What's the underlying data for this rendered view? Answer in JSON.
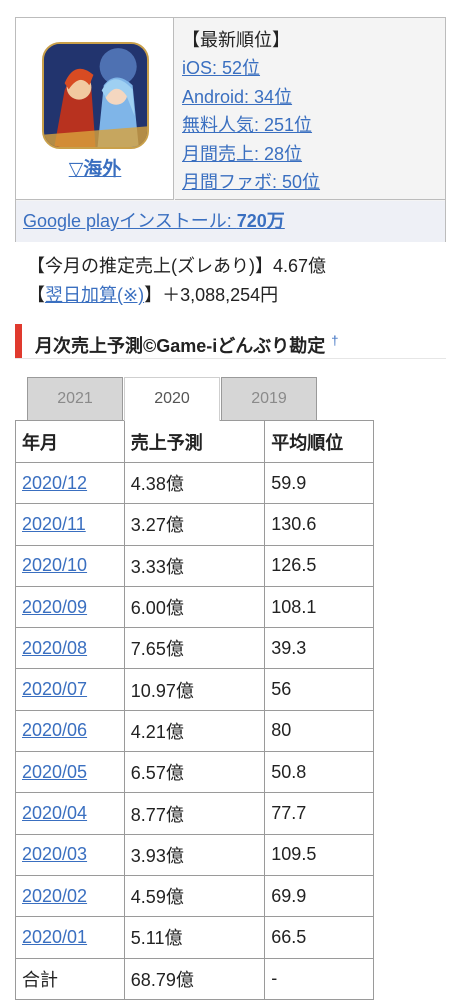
{
  "app": {
    "overseas_label": "▽海外"
  },
  "ranking": {
    "title": "【最新順位】",
    "items": [
      "iOS: 52位",
      "Android: 34位",
      "無料人気: 251位",
      "月間売上: 28位",
      "月間ファボ: 50位"
    ],
    "google_play_prefix": "Google playインストール: ",
    "google_play_value": "720万"
  },
  "estimate": {
    "line1": "【今月の推定売上(ズレあり)】4.67億",
    "bracket_open": "【",
    "link_text": "翌日加算(※)",
    "bracket_close": "】",
    "addition": "＋3,088,254円"
  },
  "section": {
    "title": "月次売上予測©Game-iどんぶり勘定",
    "dagger": "†"
  },
  "tabs": [
    "2021",
    "2020",
    "2019"
  ],
  "active_tab": "2020",
  "table": {
    "headers": [
      "年月",
      "売上予測",
      "平均順位"
    ],
    "rows": [
      [
        "2020/12",
        "4.38億",
        "59.9"
      ],
      [
        "2020/11",
        "3.27億",
        "130.6"
      ],
      [
        "2020/10",
        "3.33億",
        "126.5"
      ],
      [
        "2020/09",
        "6.00億",
        "108.1"
      ],
      [
        "2020/08",
        "7.65億",
        "39.3"
      ],
      [
        "2020/07",
        "10.97億",
        "56"
      ],
      [
        "2020/06",
        "4.21億",
        "80"
      ],
      [
        "2020/05",
        "6.57億",
        "50.8"
      ],
      [
        "2020/04",
        "8.77億",
        "77.7"
      ],
      [
        "2020/03",
        "3.93億",
        "109.5"
      ],
      [
        "2020/02",
        "4.59億",
        "69.9"
      ],
      [
        "2020/01",
        "5.11億",
        "66.5"
      ]
    ],
    "total": [
      "合計",
      "68.79億",
      "-"
    ]
  },
  "colors": {
    "link": "#3a6fc0",
    "accent_bar": "#e03a2e",
    "tab_inactive": "#d6d6d6"
  }
}
